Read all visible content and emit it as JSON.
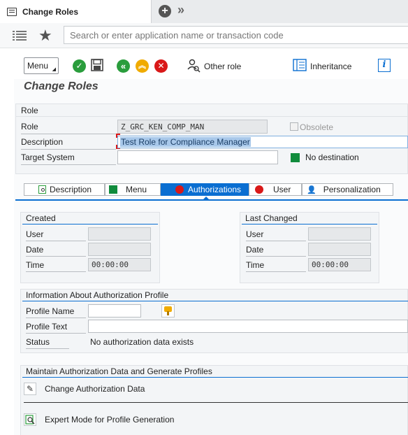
{
  "window": {
    "tab_title": "Change Roles"
  },
  "search": {
    "placeholder": "Search or enter application name or transaction code"
  },
  "toolbar": {
    "menu_label": "Menu",
    "other_role_label": "Other role",
    "inheritance_label": "Inheritance"
  },
  "page": {
    "title": "Change Roles"
  },
  "role_group": {
    "title": "Role",
    "role_label": "Role",
    "role_value": "Z_GRC_KEN_COMP_MAN",
    "obsolete_label": "Obsolete",
    "description_label": "Description",
    "description_value": "Test Role for Compliance Manager",
    "target_system_label": "Target System",
    "target_system_value": "",
    "no_destination_label": "No destination"
  },
  "tabs": [
    {
      "label": "Description"
    },
    {
      "label": "Menu"
    },
    {
      "label": "Authorizations"
    },
    {
      "label": "User"
    },
    {
      "label": "Personalization"
    }
  ],
  "created": {
    "title": "Created",
    "user_label": "User",
    "date_label": "Date",
    "time_label": "Time",
    "time_value": "00:00:00"
  },
  "last_changed": {
    "title": "Last Changed",
    "user_label": "User",
    "date_label": "Date",
    "time_label": "Time",
    "time_value": "00:00:00"
  },
  "profile_info": {
    "title": "Information About Authorization Profile",
    "profile_name_label": "Profile Name",
    "profile_text_label": "Profile Text",
    "status_label": "Status",
    "status_value": "No authorization data exists"
  },
  "maintain": {
    "title": "Maintain Authorization Data and Generate Profiles",
    "change_auth_label": "Change Authorization Data",
    "expert_mode_label": "Expert Mode for Profile Generation"
  },
  "colors": {
    "accent": "#0a6ed1",
    "green": "#108b3c",
    "red": "#d91818",
    "orange": "#f0ab00"
  }
}
